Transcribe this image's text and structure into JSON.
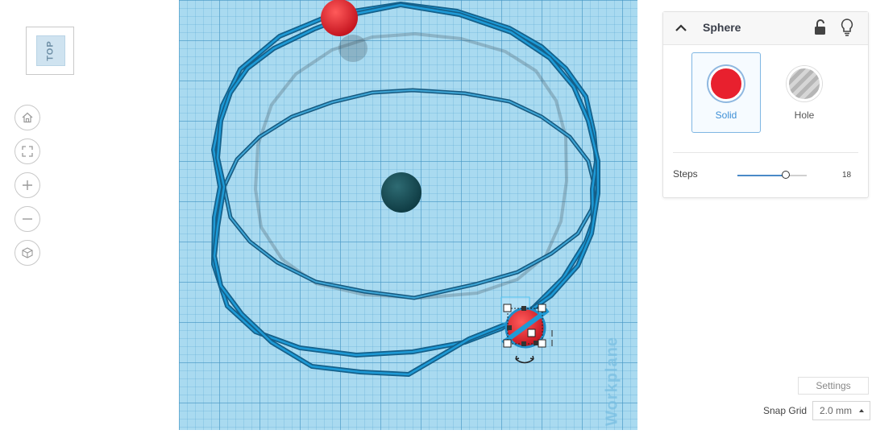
{
  "viewcube": {
    "face_label": "TOP"
  },
  "nav_buttons": [
    {
      "name": "home-view-button",
      "icon": "home-icon"
    },
    {
      "name": "fit-view-button",
      "icon": "fit-all-icon"
    },
    {
      "name": "zoom-in-button",
      "icon": "plus-icon"
    },
    {
      "name": "zoom-out-button",
      "icon": "minus-icon"
    },
    {
      "name": "perspective-button",
      "icon": "cube-icon"
    }
  ],
  "workplane": {
    "label": "Workplane"
  },
  "inspector": {
    "title": "Sphere",
    "solid_label": "Solid",
    "hole_label": "Hole",
    "steps_label": "Steps",
    "steps_value": "18",
    "steps_fraction": 0.7
  },
  "settings_label": "Settings",
  "snap_grid": {
    "label": "Snap Grid",
    "value": "2.0 mm"
  },
  "colors": {
    "solid": "#e8202e",
    "wire": "#1e86c0",
    "accent": "#3d8fd6"
  }
}
